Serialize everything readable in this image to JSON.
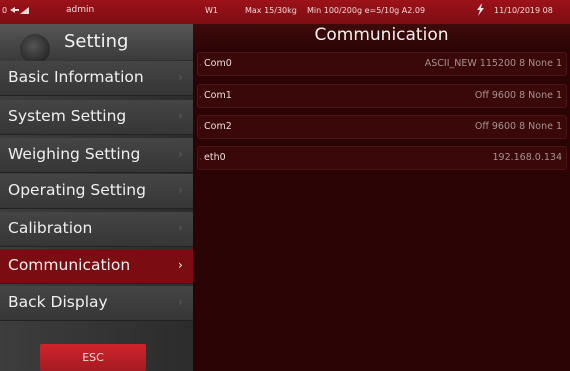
{
  "status_bar": {
    "zero": "0",
    "user": "admin",
    "w1": "W1",
    "max": "Max 15/30kg",
    "min": "Min 100/200g e=5/10g A2.09",
    "date": "11/10/2019 08"
  },
  "sidebar": {
    "title": "Setting",
    "items": [
      {
        "label": "Basic Information"
      },
      {
        "label": "System Setting"
      },
      {
        "label": "Weighing Setting"
      },
      {
        "label": "Operating Setting"
      },
      {
        "label": "Calibration"
      },
      {
        "label": "Communication"
      },
      {
        "label": "Back Display"
      }
    ],
    "active_index": 5,
    "esc_label": "ESC"
  },
  "main": {
    "title": "Communication",
    "rows": [
      {
        "name": "Com0",
        "value": "ASCII_NEW 115200 8 None 1"
      },
      {
        "name": "Com1",
        "value": "Off 9600 8 None 1"
      },
      {
        "name": "Com2",
        "value": "Off 9600 8 None 1"
      },
      {
        "name": "eth0",
        "value": "192.168.0.134"
      }
    ]
  },
  "colors": {
    "accent_red": "#7b0c12",
    "esc_red": "#c8222a",
    "panel_bg": "#2a0404"
  },
  "icons": [
    "signal-icon",
    "lightning-icon",
    "gear-icon",
    "chevron-right-icon"
  ]
}
